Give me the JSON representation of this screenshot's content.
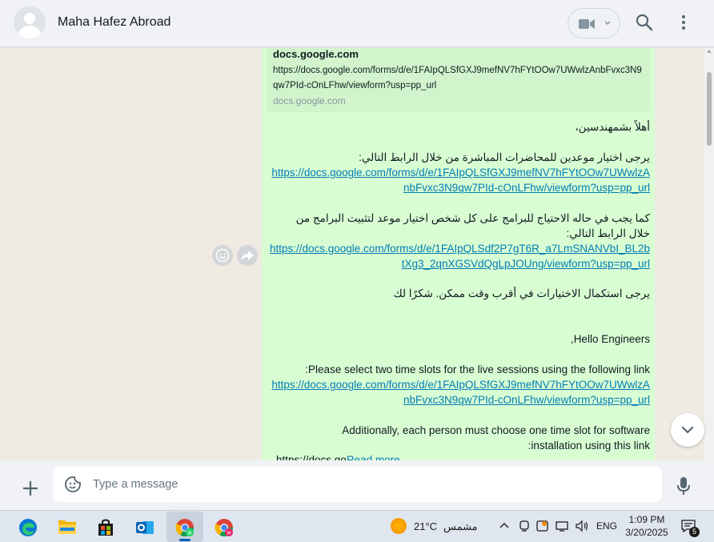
{
  "header": {
    "contact_name": "Maha Hafez Abroad",
    "icons": [
      "video-call-icon",
      "chevron-down-icon",
      "search-icon",
      "menu-icon"
    ]
  },
  "link_preview": {
    "title": "docs.google.com",
    "url": "https://docs.google.com/forms/d/e/1FAIpQLSfGXJ9mefNV7hFYtOOw7UWwlzAnbFvxc3N9qw7PId-cOnLFhw/viewform?usp=pp_url",
    "domain": "docs.google.com"
  },
  "message": {
    "ar_greeting": "أهلاً بشمهندسين،",
    "ar_line1": "يرجى اختيار موعدين للمحاضرات المباشرة من خلال الرابط التالي:",
    "link1": "https://docs.google.com/forms/d/e/1FAIpQLSfGXJ9mefNV7hFYtOOw7UWwlzAnbFvxc3N9qw7PId-cOnLFhw/viewform?usp=pp_url",
    "ar_line2": "كما يجب في حاله الاحتياج للبرامج على كل شخص اختيار موعد لتثبيت  البرامج من خلال الرابط التالي:",
    "link2": "https://docs.google.com/forms/d/e/1FAIpQLSdf2P7gT6R_a7LmSNANVbI_BL2btXg3_2qnXGSVdQgLpJOUng/viewform?usp=pp_url",
    "ar_closing": "يرجى استكمال الاختيارات في أقرب وقت ممكن. شكرًا لك",
    "en_greeting": "Hello Engineers,",
    "en_line1": "Please select two time slots for the live sessions using the following link:",
    "link3": "https://docs.google.com/forms/d/e/1FAIpQLSfGXJ9mefNV7hFYtOOw7UWwlzAnbFvxc3N9qw7PId-cOnLFhw/viewform?usp=pp_url",
    "en_line2": "Additionally, each person must choose one time slot for software installation using this link:",
    "truncated_text": "https://docs.go",
    "read_more": "Read more"
  },
  "composer": {
    "placeholder": "Type a message"
  },
  "taskbar": {
    "apps": [
      "edge-icon",
      "file-explorer-icon",
      "store-icon",
      "outlook-icon",
      "chrome-whatsapp-icon",
      "chrome-whatsapp-icon-2"
    ],
    "temperature": "21°C",
    "weather": "مشمس",
    "language": "ENG",
    "time": "1:09 PM",
    "date": "3/20/2025",
    "notification_count": "5"
  }
}
